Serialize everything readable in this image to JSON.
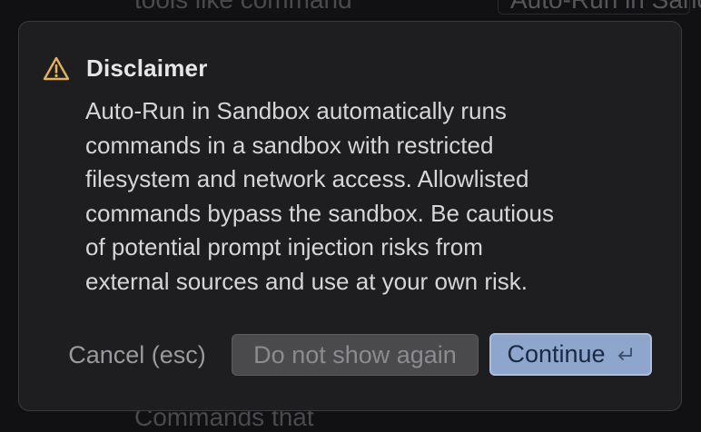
{
  "background": {
    "top_left_text": "tools like command",
    "top_right_text": "Auto-Run in Sand",
    "bottom_left_text": "Commands that"
  },
  "dialog": {
    "icon": "warning-triangle-icon",
    "title": "Disclaimer",
    "body_lines": [
      "Auto-Run in Sandbox automatically runs",
      "commands in a sandbox with restricted",
      "filesystem and network access. Allowlisted",
      "commands bypass the sandbox. Be cautious",
      "of potential prompt injection risks from",
      "external sources and use at your own risk."
    ],
    "buttons": {
      "cancel": "Cancel (esc)",
      "dont_show": "Do not show again",
      "continue": "Continue",
      "continue_shortcut_icon": "enter-key-icon"
    }
  },
  "colors": {
    "accent": "#8fa6cc",
    "warning": "#e2b15a",
    "dialog_bg": "#1e1e20"
  }
}
